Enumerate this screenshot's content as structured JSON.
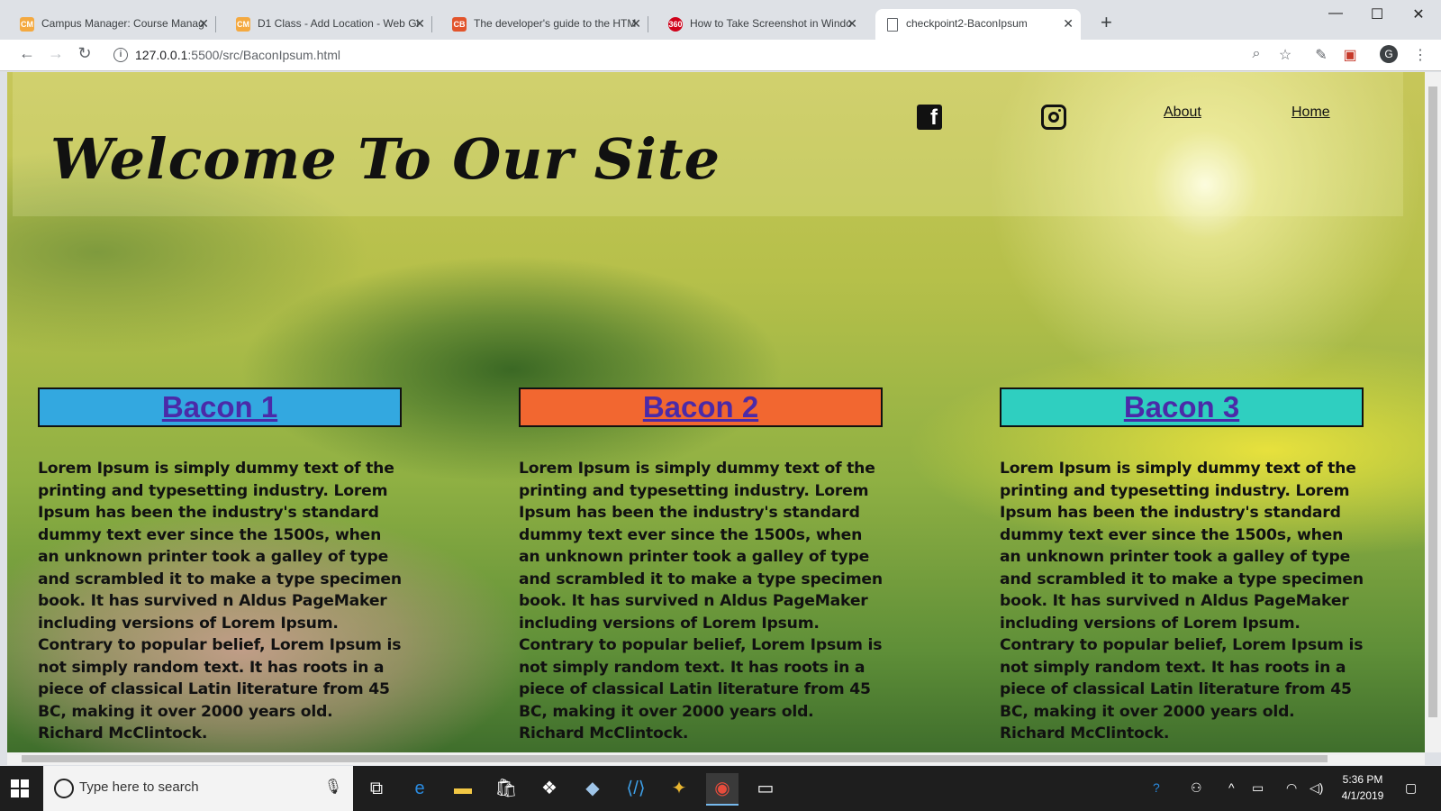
{
  "browser": {
    "tabs": [
      {
        "title": "Campus Manager: Course Manag",
        "favicon": "campus-icon",
        "color": "#f4a940"
      },
      {
        "title": "D1 Class - Add Location - Web Gi",
        "favicon": "campus-icon",
        "color": "#f4a940"
      },
      {
        "title": "The developer's guide to the HTM",
        "favicon": "cb-icon",
        "color": "#e2542b"
      },
      {
        "title": "How to Take Screenshot in Windo",
        "favicon": "360-icon",
        "color": "#d0021b"
      },
      {
        "title": "checkpoint2-BaconIpsum",
        "favicon": "page-icon",
        "color": "#5f6368"
      }
    ],
    "url_host": "127.0.0.1",
    "url_path": ":5500/src/BaconIpsum.html",
    "profile_initial": "G"
  },
  "page": {
    "title": "Welcome To Our Site",
    "nav": {
      "about": "About",
      "home": "Home"
    },
    "columns": [
      {
        "heading": "Bacon 1",
        "color": "#33a8e0",
        "text": "Lorem Ipsum is simply dummy text of the printing and typesetting industry. Lorem Ipsum has been the industry's standard dummy text ever since the 1500s, when an unknown printer took a galley of type and scrambled it to make a type specimen book. It has survived n Aldus PageMaker including versions of Lorem Ipsum. Contrary to popular belief, Lorem Ipsum is not simply random text. It has roots in a piece of classical Latin literature from 45 BC, making it over 2000 years old. Richard McClintock."
      },
      {
        "heading": "Bacon 2",
        "color": "#f26730",
        "text": "Lorem Ipsum is simply dummy text of the printing and typesetting industry. Lorem Ipsum has been the industry's standard dummy text ever since the 1500s, when an unknown printer took a galley of type and scrambled it to make a type specimen book. It has survived n Aldus PageMaker including versions of Lorem Ipsum. Contrary to popular belief, Lorem Ipsum is not simply random text. It has roots in a piece of classical Latin literature from 45 BC, making it over 2000 years old. Richard McClintock."
      },
      {
        "heading": "Bacon 3",
        "color": "#2fcfc0",
        "text": "Lorem Ipsum is simply dummy text of the printing and typesetting industry. Lorem Ipsum has been the industry's standard dummy text ever since the 1500s, when an unknown printer took a galley of type and scrambled it to make a type specimen book. It has survived n Aldus PageMaker including versions of Lorem Ipsum. Contrary to popular belief, Lorem Ipsum is not simply random text. It has roots in a piece of classical Latin literature from 45 BC, making it over 2000 years old. Richard McClintock."
      }
    ]
  },
  "taskbar": {
    "search_placeholder": "Type here to search",
    "time": "5:36 PM",
    "date": "4/1/2019"
  }
}
